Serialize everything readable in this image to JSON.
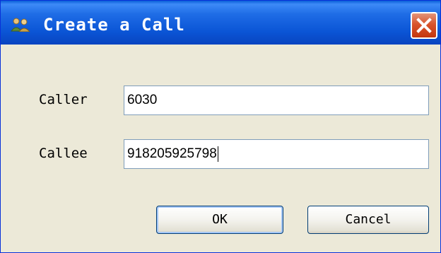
{
  "window": {
    "title": "Create a Call",
    "close_icon": "close-icon",
    "app_icon": "users-icon"
  },
  "form": {
    "caller": {
      "label": "Caller",
      "value": "6030"
    },
    "callee": {
      "label": "Callee",
      "value": "918205925798"
    }
  },
  "buttons": {
    "ok_label": "OK",
    "cancel_label": "Cancel"
  },
  "colors": {
    "titlebar": "#0b55d6",
    "dialog_background": "#ece9d8",
    "close_button": "#d9542c",
    "input_border": "#7f9db9"
  }
}
